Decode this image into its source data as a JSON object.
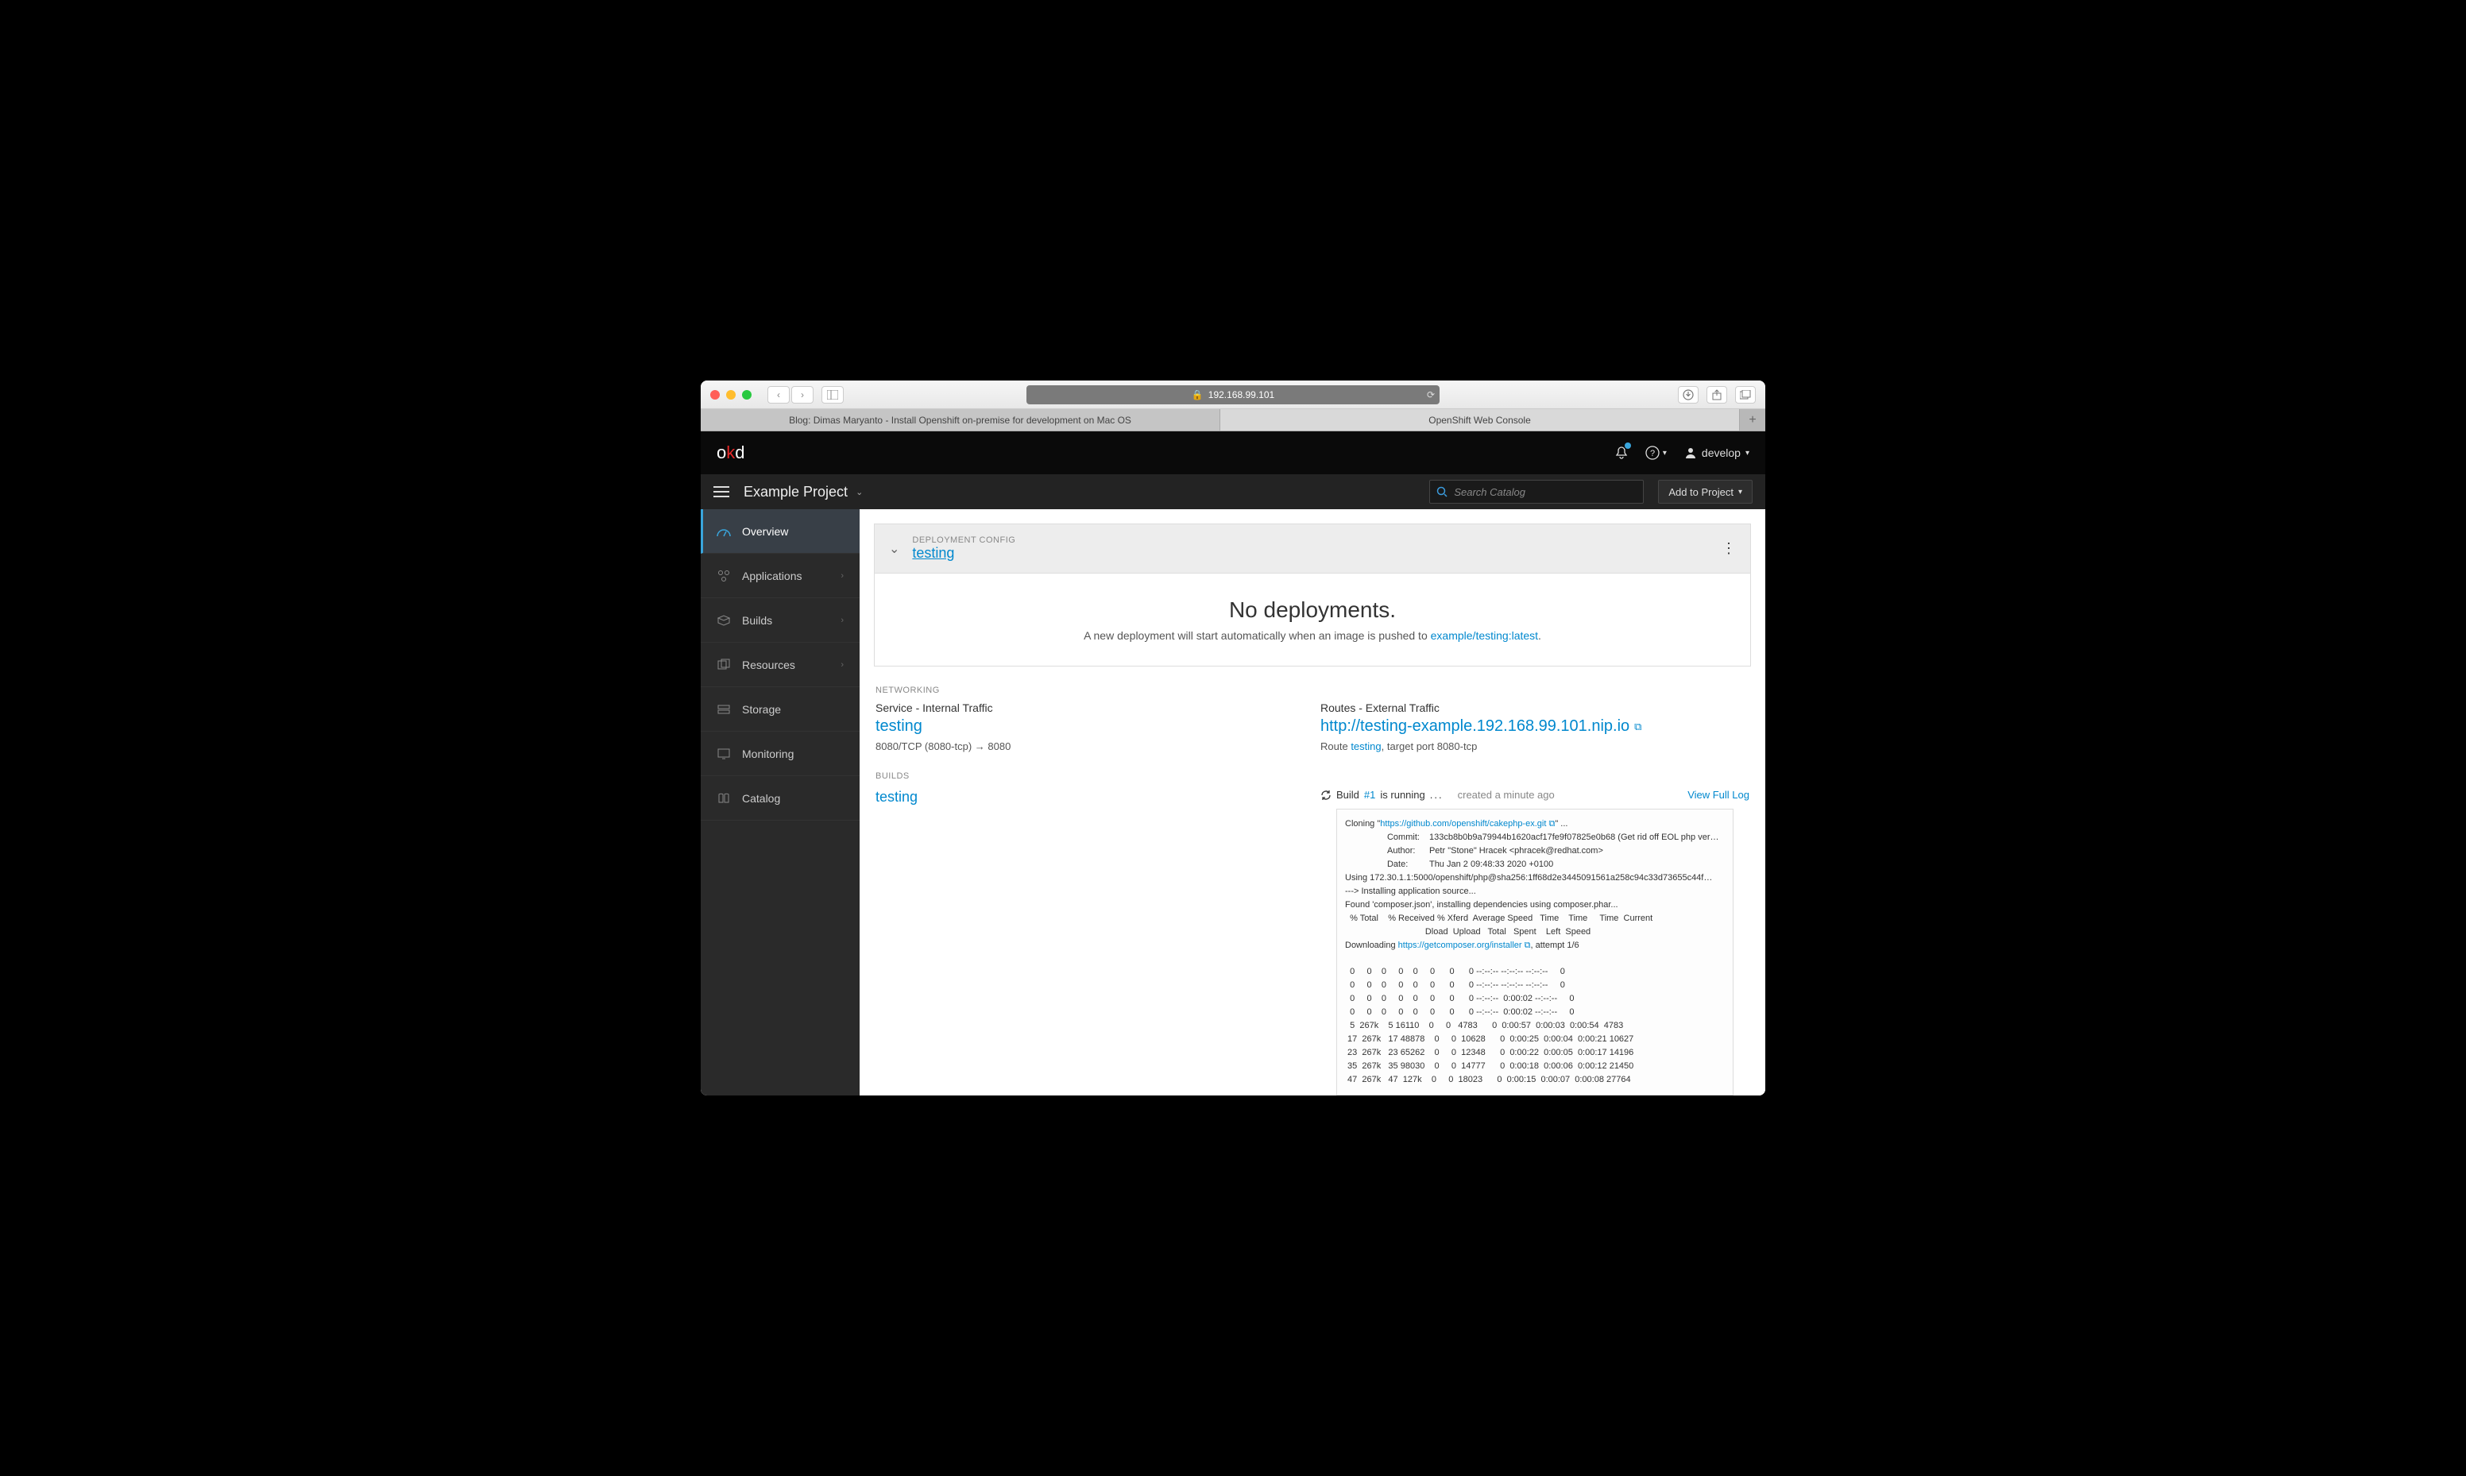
{
  "browser": {
    "url": "192.168.99.101",
    "tabs": [
      "Blog: Dimas Maryanto - Install Openshift on-premise for development on Mac OS",
      "OpenShift Web Console"
    ]
  },
  "header": {
    "logo_o": "o",
    "logo_k": "k",
    "logo_d": "d",
    "username": "develop"
  },
  "projectbar": {
    "project_name": "Example Project",
    "search_placeholder": "Search Catalog",
    "add_to_project": "Add to Project"
  },
  "sidenav": {
    "items": [
      {
        "label": "Overview",
        "icon": "dashboard"
      },
      {
        "label": "Applications",
        "icon": "apps",
        "expandable": true
      },
      {
        "label": "Builds",
        "icon": "builds",
        "expandable": true
      },
      {
        "label": "Resources",
        "icon": "resources",
        "expandable": true
      },
      {
        "label": "Storage",
        "icon": "storage"
      },
      {
        "label": "Monitoring",
        "icon": "monitor"
      },
      {
        "label": "Catalog",
        "icon": "catalog"
      }
    ]
  },
  "deployment": {
    "type_label": "DEPLOYMENT CONFIG",
    "name": "testing",
    "empty_title": "No deployments.",
    "empty_sub_prefix": "A new deployment will start automatically when an image is pushed to ",
    "empty_sub_link": "example/testing:latest"
  },
  "networking": {
    "label": "NETWORKING",
    "service": {
      "title": "Service - Internal Traffic",
      "name": "testing",
      "ports": "8080/TCP (8080-tcp) → 8080"
    },
    "route": {
      "title": "Routes - External Traffic",
      "url": "http://testing-example.192.168.99.101.nip.io",
      "sub_prefix": "Route ",
      "sub_link": "testing",
      "sub_suffix": ", target port 8080-tcp"
    }
  },
  "builds": {
    "label": "BUILDS",
    "name": "testing",
    "status_prefix": "Build ",
    "status_num": "#1",
    "status_suffix": " is running",
    "created": "created a minute ago",
    "view_log": "View Full Log",
    "log_clone_prefix": "Cloning \"",
    "log_clone_url": "https://github.com/openshift/cakephp-ex.git",
    "log_clone_suffix": "\" ...",
    "log_lines_1": "\tCommit:\t133cb8b0b9a79944b1620acf17fe9f07825e0b68 (Get rid off EOL php ver…\n\tAuthor:\tPetr \"Stone\" Hracek <phracek@redhat.com>\n\tDate:\tThu Jan 2 09:48:33 2020 +0100\nUsing 172.30.1.1:5000/openshift/php@sha256:1ff68d2e3445091561a258c94c33d73655c44f…\n---> Installing application source...\nFound 'composer.json', installing dependencies using composer.phar...\n  % Total    % Received % Xferd  Average Speed   Time    Time     Time  Current\n                                 Dload  Upload   Total   Spent    Left  Speed",
    "log_dl_prefix": "Downloading ",
    "log_dl_url": "https://getcomposer.org/installer",
    "log_dl_suffix": ", attempt 1/6",
    "log_table": "\n  0     0    0     0    0     0      0      0 --:--:-- --:--:-- --:--:--     0\n  0     0    0     0    0     0      0      0 --:--:-- --:--:-- --:--:--     0\n  0     0    0     0    0     0      0      0 --:--:--  0:00:02 --:--:--     0\n  0     0    0     0    0     0      0      0 --:--:--  0:00:02 --:--:--     0\n  5  267k    5 16110    0     0   4783      0  0:00:57  0:00:03  0:00:54  4783\n 17  267k   17 48878    0     0  10628      0  0:00:25  0:00:04  0:00:21 10627\n 23  267k   23 65262    0     0  12348      0  0:00:22  0:00:05  0:00:17 14196\n 35  267k   35 98030    0     0  14777      0  0:00:18  0:00:06  0:00:12 21450\n 47  267k   47  127k    0     0  18023      0  0:00:15  0:00:07  0:00:08 27764"
  }
}
